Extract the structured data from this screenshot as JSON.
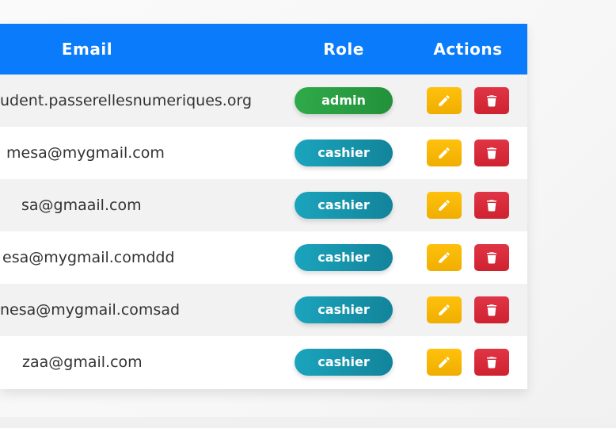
{
  "table": {
    "headers": {
      "email": "Email",
      "role": "Role",
      "actions": "Actions"
    },
    "rows": [
      {
        "email": "udent.passerellesnumeriques.org",
        "role": "admin"
      },
      {
        "email": "mesa@mygmail.com",
        "role": "cashier"
      },
      {
        "email": "sa@gmaail.com",
        "role": "cashier"
      },
      {
        "email": "esa@mygmail.comddd",
        "role": "cashier"
      },
      {
        "email": "nesa@mygmail.comsad",
        "role": "cashier"
      },
      {
        "email": "zaa@gmail.com",
        "role": "cashier"
      }
    ]
  },
  "icons": {
    "edit": "pencil-icon",
    "delete": "trash-icon"
  },
  "colors": {
    "header_bg": "#0a7bfb",
    "admin_badge": "#28a745",
    "cashier_badge": "#17a2b8",
    "edit_button": "#ffc107",
    "delete_button": "#dc3545"
  }
}
